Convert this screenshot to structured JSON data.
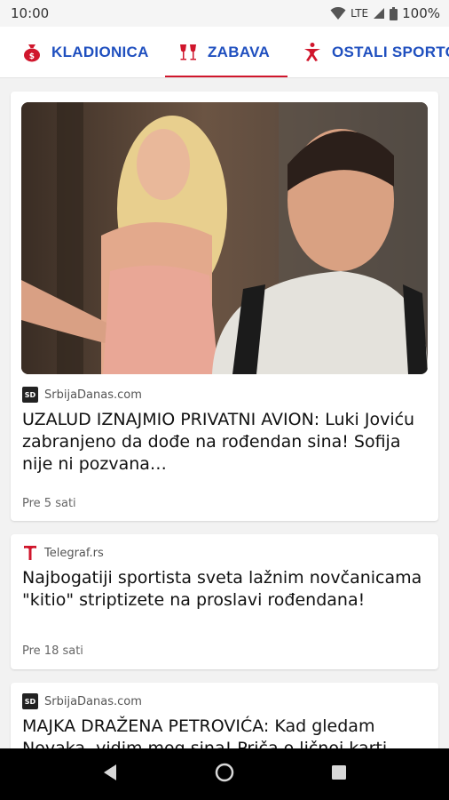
{
  "status_bar": {
    "time": "10:00",
    "network": "LTE",
    "battery": "100%"
  },
  "tabs": [
    {
      "label": "KLADIONICA",
      "icon": "money-bag-icon",
      "active": false
    },
    {
      "label": "ZABAVA",
      "icon": "wine-glasses-icon",
      "active": true
    },
    {
      "label": "OSTALI SPORTOVI",
      "icon": "runner-icon",
      "active": false
    }
  ],
  "colors": {
    "tab_text": "#1f4fbf",
    "accent_red": "#d0162c"
  },
  "articles": [
    {
      "source": "SrbijaDanas.com",
      "source_logo": "SD",
      "headline": "UZALUD IZNAJMIO PRIVATNI AVION: Luki Joviću zabranjeno da dođe na rođendan sina! Sofija nije ni pozvana…",
      "time": "Pre 5 sati",
      "has_image": true
    },
    {
      "source": "Telegraf.rs",
      "source_logo": "telegraf-t-logo",
      "headline": "Najbogatiji sportista sveta lažnim novčanicama \"kitio\" striptizete na proslavi rođendana!",
      "time": "Pre 18 sati",
      "has_image": false
    },
    {
      "source": "SrbijaDanas.com",
      "source_logo": "SD",
      "headline": "MAJKA DRAŽENA PETROVIĆA: Kad gledam Novaka, vidim mog sina! Priča o ličnoj karti",
      "time": "",
      "has_image": false
    }
  ],
  "nav": {
    "back": "back-icon",
    "home": "home-icon",
    "recents": "recents-icon"
  }
}
